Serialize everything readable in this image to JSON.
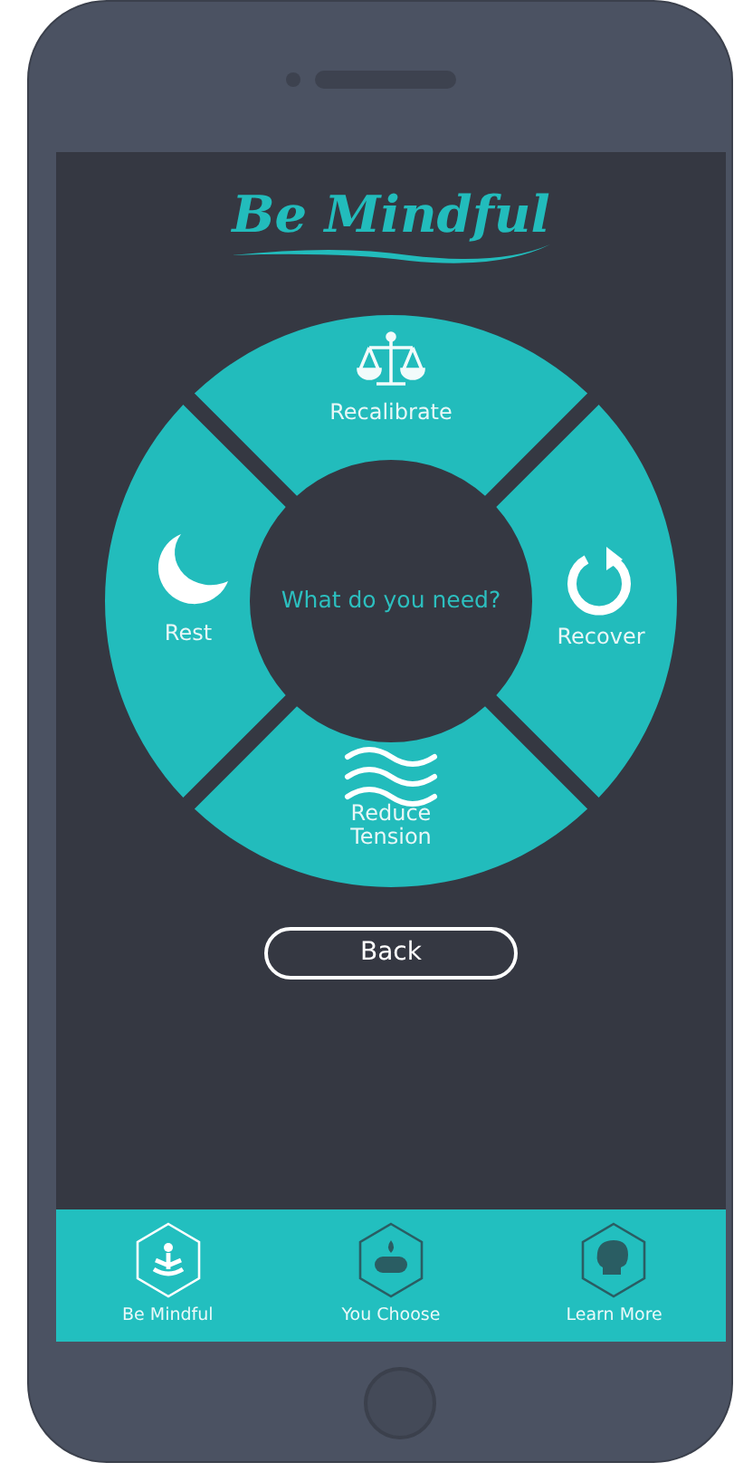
{
  "app": {
    "title": "Be Mindful"
  },
  "wheel": {
    "prompt": "What do you need?",
    "options": [
      {
        "label": "Recalibrate",
        "kind": "scale"
      },
      {
        "label": "Recover",
        "kind": "refresh"
      },
      {
        "label": "Reduce Tension",
        "kind": "waves"
      },
      {
        "label": "Rest",
        "kind": "moon"
      }
    ]
  },
  "back_button": "Back",
  "tabs": [
    {
      "label": "Be Mindful",
      "selected": true,
      "kind": "meditation"
    },
    {
      "label": "You Choose",
      "selected": false,
      "kind": "candle"
    },
    {
      "label": "Learn More",
      "selected": false,
      "kind": "head"
    }
  ]
}
